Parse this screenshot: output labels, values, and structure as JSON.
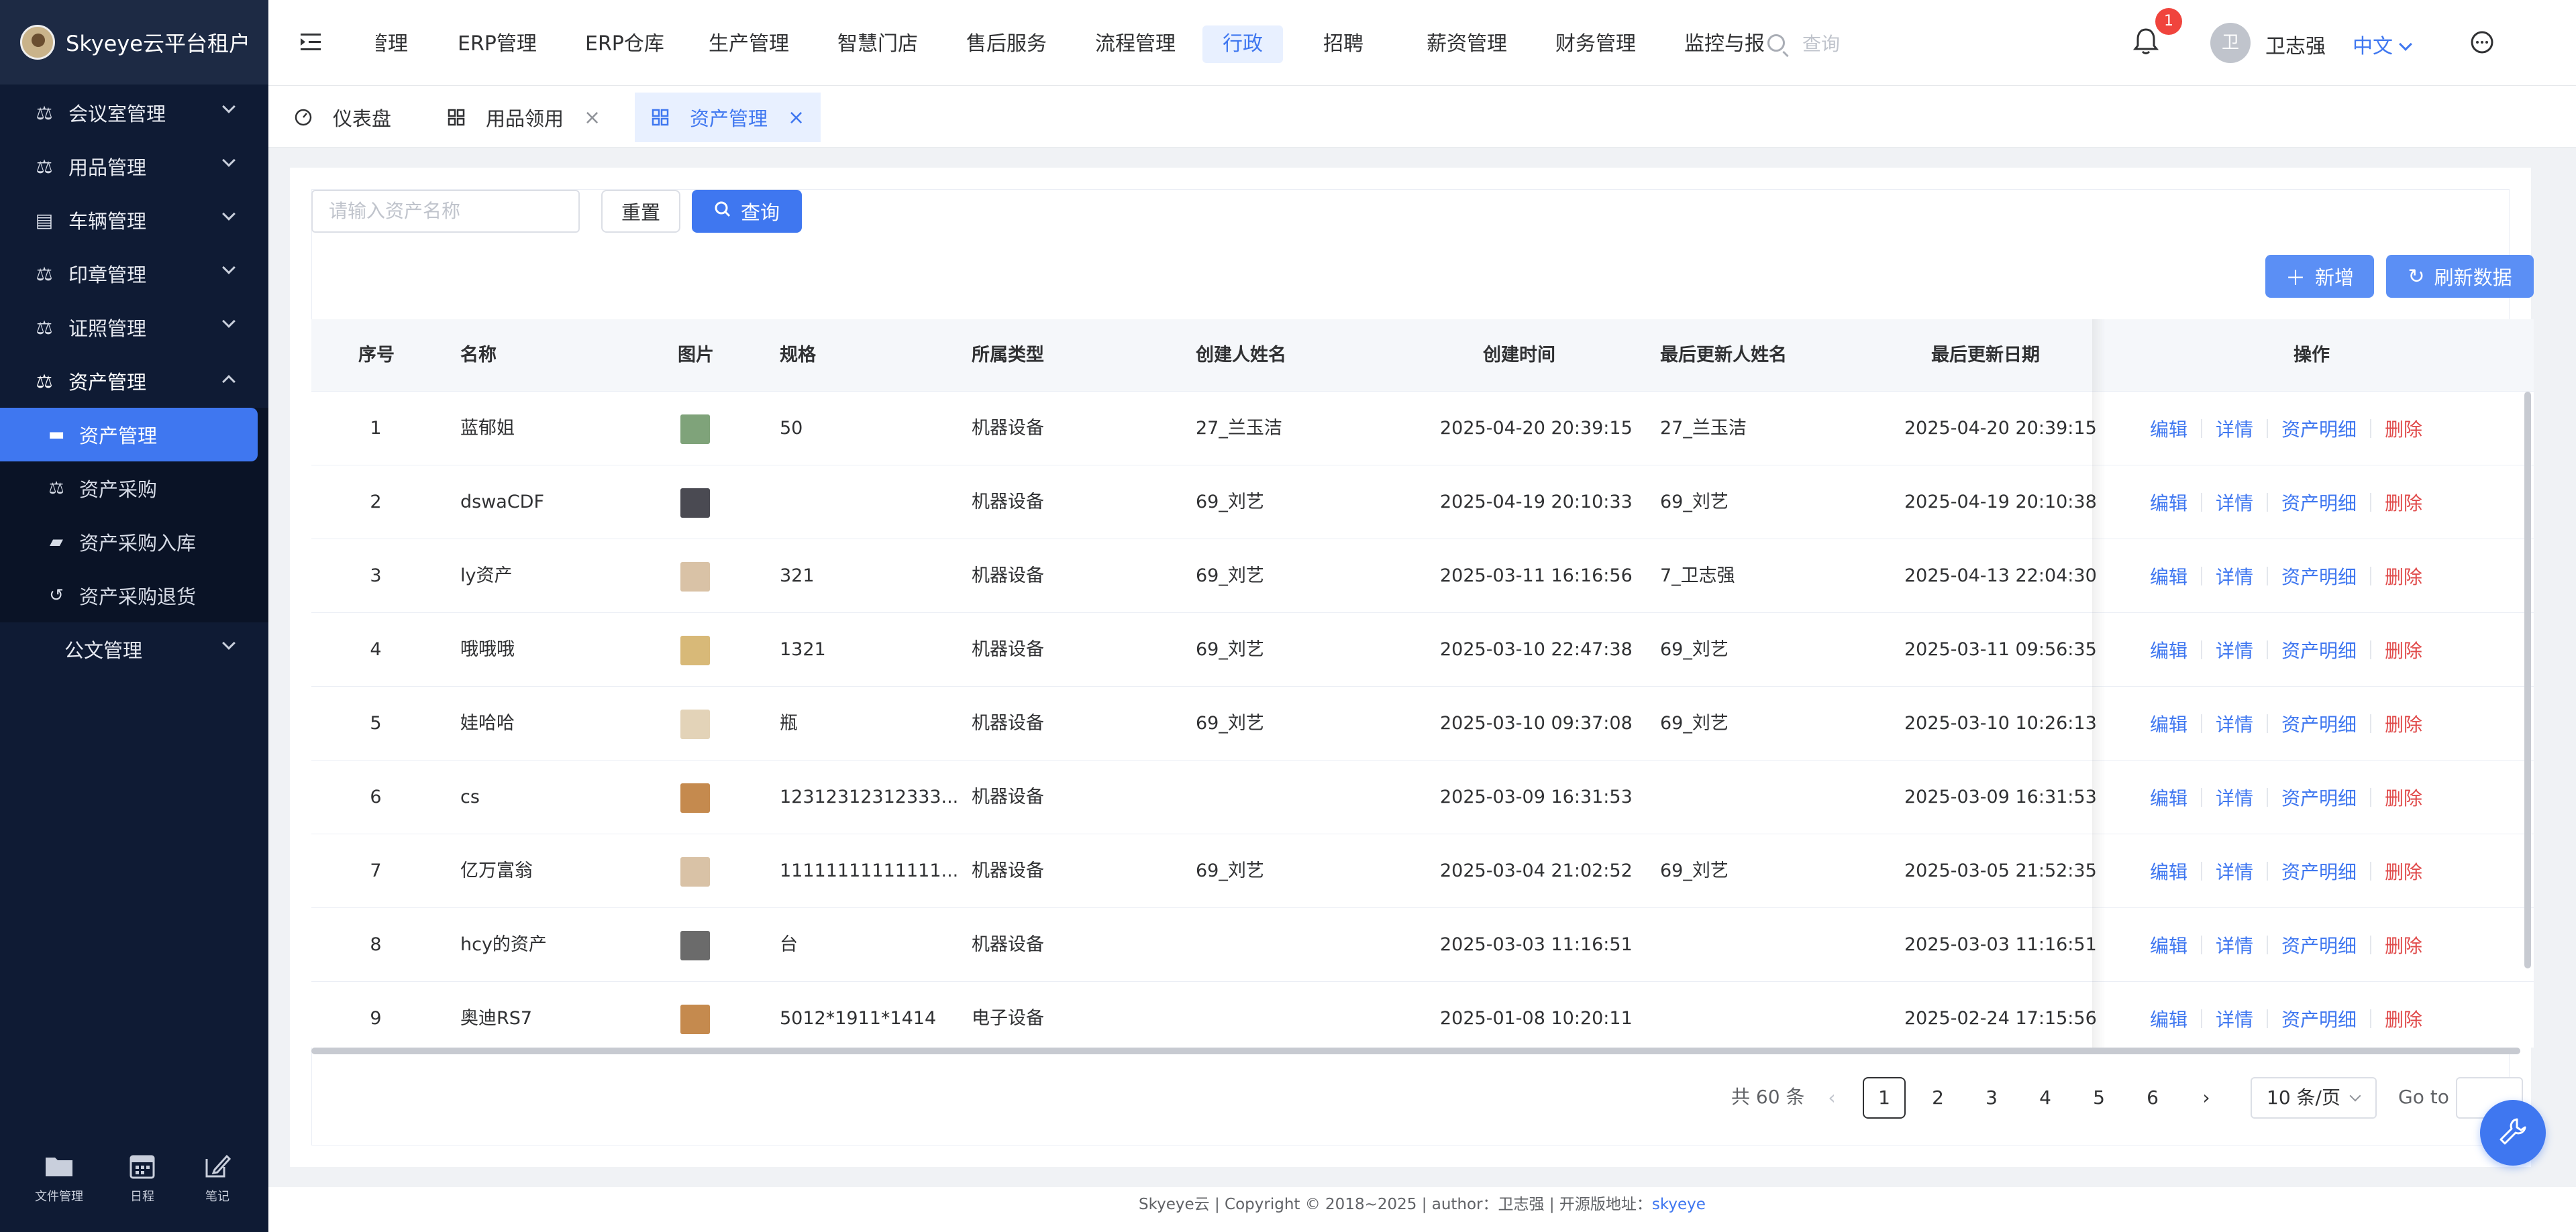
{
  "app": {
    "title": "Skyeye云平台租户"
  },
  "sidebar": {
    "menus": [
      {
        "label": "会议室管理",
        "icon": "scale-icon",
        "expanded": false
      },
      {
        "label": "用品管理",
        "icon": "scale-icon",
        "expanded": false
      },
      {
        "label": "车辆管理",
        "icon": "inbox-icon",
        "expanded": false
      },
      {
        "label": "印章管理",
        "icon": "scale-icon",
        "expanded": false
      },
      {
        "label": "证照管理",
        "icon": "scale-icon",
        "expanded": false
      },
      {
        "label": "资产管理",
        "icon": "scale-icon",
        "expanded": true
      }
    ],
    "submenu": [
      {
        "label": "资产管理",
        "icon": "card-icon",
        "active": true
      },
      {
        "label": "资产采购",
        "icon": "scale-icon"
      },
      {
        "label": "资产采购入库",
        "icon": "folder-open-icon"
      },
      {
        "label": "资产采购退货",
        "icon": "undo-icon"
      }
    ],
    "extra_menu": {
      "label": "公文管理"
    },
    "tools": [
      {
        "label": "文件管理",
        "icon": "folder-icon"
      },
      {
        "label": "日程",
        "icon": "calendar-icon"
      },
      {
        "label": "笔记",
        "icon": "edit-icon"
      }
    ]
  },
  "topnav": {
    "items": [
      "管理",
      "ERP管理",
      "ERP仓库",
      "生产管理",
      "智慧门店",
      "售后服务",
      "流程管理",
      "行政",
      "招聘",
      "薪资管理",
      "财务管理",
      "监控与报"
    ],
    "active_index": 7,
    "search_placeholder": "查询",
    "notification_count": "1",
    "user_avatar_text": "卫",
    "user_name": "卫志强",
    "language": "中文"
  },
  "tabs": [
    {
      "label": "仪表盘",
      "icon": "dashboard-icon",
      "closable": false
    },
    {
      "label": "用品领用",
      "icon": "grid-icon",
      "closable": true
    },
    {
      "label": "资产管理",
      "icon": "grid-icon",
      "closable": true,
      "active": true
    }
  ],
  "filters": {
    "asset_name_placeholder": "请输入资产名称",
    "reset_label": "重置",
    "query_label": "查询"
  },
  "toolbar": {
    "add_label": "新增",
    "refresh_label": "刷新数据"
  },
  "table": {
    "columns": [
      "序号",
      "名称",
      "图片",
      "规格",
      "所属类型",
      "创建人姓名",
      "创建时间",
      "最后更新人姓名",
      "最后更新日期",
      "操作"
    ],
    "actions": {
      "edit": "编辑",
      "detail": "详情",
      "ledger": "资产明细",
      "delete": "删除"
    },
    "rows": [
      {
        "no": "1",
        "name": "蓝郁姐",
        "spec": "50",
        "type": "机器设备",
        "creator": "27_兰玉洁",
        "created": "2025-04-20 20:39:15",
        "updater": "27_兰玉洁",
        "updated": "2025-04-20 20:39:15",
        "thumb_color": "#7fa37a"
      },
      {
        "no": "2",
        "name": "dswaCDF",
        "spec": "",
        "type": "机器设备",
        "creator": "69_刘艺",
        "created": "2025-04-19 20:10:33",
        "updater": "69_刘艺",
        "updated": "2025-04-19 20:10:38",
        "thumb_color": "#4a4a52"
      },
      {
        "no": "3",
        "name": "ly资产",
        "spec": "321",
        "type": "机器设备",
        "creator": "69_刘艺",
        "created": "2025-03-11 16:16:56",
        "updater": "7_卫志强",
        "updated": "2025-04-13 22:04:30",
        "thumb_color": "#d9c2a6"
      },
      {
        "no": "4",
        "name": "哦哦哦",
        "spec": "1321",
        "type": "机器设备",
        "creator": "69_刘艺",
        "created": "2025-03-10 22:47:38",
        "updater": "69_刘艺",
        "updated": "2025-03-11 09:56:35",
        "thumb_color": "#d8b978"
      },
      {
        "no": "5",
        "name": "娃哈哈",
        "spec": "瓶",
        "type": "机器设备",
        "creator": "69_刘艺",
        "created": "2025-03-10 09:37:08",
        "updater": "69_刘艺",
        "updated": "2025-03-10 10:26:13",
        "thumb_color": "#e3d3b8"
      },
      {
        "no": "6",
        "name": "cs",
        "spec": "12312312312333...",
        "type": "机器设备",
        "creator": "",
        "created": "2025-03-09 16:31:53",
        "updater": "",
        "updated": "2025-03-09 16:31:53",
        "thumb_color": "#c58a4e"
      },
      {
        "no": "7",
        "name": "亿万富翁",
        "spec": "11111111111111...",
        "type": "机器设备",
        "creator": "69_刘艺",
        "created": "2025-03-04 21:02:52",
        "updater": "69_刘艺",
        "updated": "2025-03-05 21:52:35",
        "thumb_color": "#d9c2a6"
      },
      {
        "no": "8",
        "name": "hcy的资产",
        "spec": "台",
        "type": "机器设备",
        "creator": "",
        "created": "2025-03-03 11:16:51",
        "updater": "",
        "updated": "2025-03-03 11:16:51",
        "thumb_color": "#6b6b6b"
      },
      {
        "no": "9",
        "name": "奥迪RS7",
        "spec": "5012*1911*1414",
        "type": "电子设备",
        "creator": "",
        "created": "2025-01-08 10:20:11",
        "updater": "",
        "updated": "2025-02-24 17:15:56",
        "thumb_color": "#c58a4e"
      }
    ]
  },
  "pagination": {
    "total_text": "共 60 条",
    "pages": [
      "1",
      "2",
      "3",
      "4",
      "5",
      "6"
    ],
    "current": "1",
    "page_size": "10 条/页",
    "goto_label": "Go to"
  },
  "footer": {
    "text": "Skyeye云 | Copyright © 2018~2025 | author：卫志强 | 开源版地址：",
    "link": "skyeye"
  },
  "colors": {
    "primary": "#3f77f0",
    "sidebar_bg": "#0f1b34",
    "danger": "#e04a4a"
  }
}
